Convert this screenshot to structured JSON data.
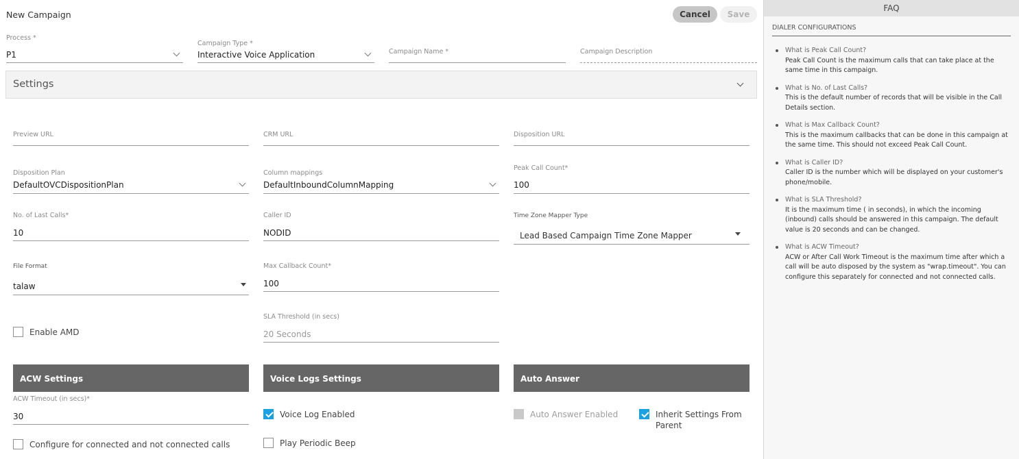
{
  "header": {
    "title": "New Campaign",
    "cancel_label": "Cancel",
    "save_label": "Save"
  },
  "top_fields": {
    "process": {
      "label": "Process *",
      "value": "P1"
    },
    "campaign_type": {
      "label": "Campaign Type *",
      "value": "Interactive Voice Application"
    },
    "campaign_name": {
      "label": "Campaign Name *",
      "value": ""
    },
    "campaign_description": {
      "label": "Campaign Description",
      "value": ""
    }
  },
  "settings": {
    "title": "Settings",
    "preview_url": {
      "label": "Preview URL",
      "value": ""
    },
    "crm_url": {
      "label": "CRM URL",
      "value": ""
    },
    "disposition_url": {
      "label": "Disposition URL",
      "value": ""
    },
    "disposition_plan": {
      "label": "Disposition Plan",
      "value": "DefaultOVCDispositionPlan"
    },
    "column_mappings": {
      "label": "Column mappings",
      "value": "DefaultInboundColumnMapping"
    },
    "peak_call_count": {
      "label": "Peak Call Count*",
      "value": "100"
    },
    "no_of_last_calls": {
      "label": "No. of Last Calls*",
      "value": "10"
    },
    "caller_id": {
      "label": "Caller ID",
      "value": "NODID"
    },
    "time_zone_mapper_type": {
      "label": "Time Zone Mapper Type",
      "value": "Lead Based Campaign Time Zone Mapper"
    },
    "file_format": {
      "label": "File Format",
      "value": "talaw"
    },
    "max_callback_count": {
      "label": "Max Callback Count*",
      "value": "100"
    },
    "sla_threshold": {
      "label": "SLA Threshold (in secs)",
      "value": "20 Seconds"
    },
    "enable_amd": {
      "label": "Enable AMD",
      "checked": false
    }
  },
  "acw": {
    "title": "ACW Settings",
    "timeout": {
      "label": "ACW Timeout (in secs)*",
      "value": "30"
    },
    "configure_connected": {
      "label": "Configure for connected and not connected calls",
      "checked": false
    }
  },
  "voice_logs": {
    "title": "Voice Logs Settings",
    "voice_log_enabled": {
      "label": "Voice Log Enabled",
      "checked": true
    },
    "play_periodic_beep": {
      "label": "Play Periodic Beep",
      "checked": false
    }
  },
  "auto_answer": {
    "title": "Auto Answer",
    "auto_answer_enabled": {
      "label": "Auto Answer Enabled",
      "checked": false,
      "disabled": true
    },
    "inherit_settings": {
      "label": "Inherit Settings From Parent",
      "checked": true
    }
  },
  "faq": {
    "title": "FAQ",
    "section": "DIALER CONFIGURATIONS",
    "items": [
      {
        "q": "What is Peak Call Count?",
        "a": "Peak Call Count is the maximum calls that can take place at the same time in this campaign."
      },
      {
        "q": "What is No. of Last Calls?",
        "a": "This is the default number of records that will be visible in the Call Details section."
      },
      {
        "q": "What is Max Callback Count?",
        "a": "This is the maximum callbacks that can be done in this campaign at the same time. This should not exceed Peak Call Count."
      },
      {
        "q": "What is Caller ID?",
        "a": "Caller ID is the number which will be displayed on your customer's phone/mobile."
      },
      {
        "q": "What is SLA Threshold?",
        "a": "It is the maximum time ( in seconds), in which the incoming (inbound) calls should be answered in this campaign. The default value is 20 seconds and can be changed."
      },
      {
        "q": "What is ACW Timeout?",
        "a": "ACW or After Call Work Timeout is the maximum time after which a call will be auto disposed by the system as \"wrap.timeout\". You can configure this separately for connected and not connected calls."
      }
    ]
  },
  "colors": {
    "accent_checkbox": "#1ba1e2",
    "section_header_bg": "#666666",
    "faq_bg": "#f7f7f7"
  }
}
